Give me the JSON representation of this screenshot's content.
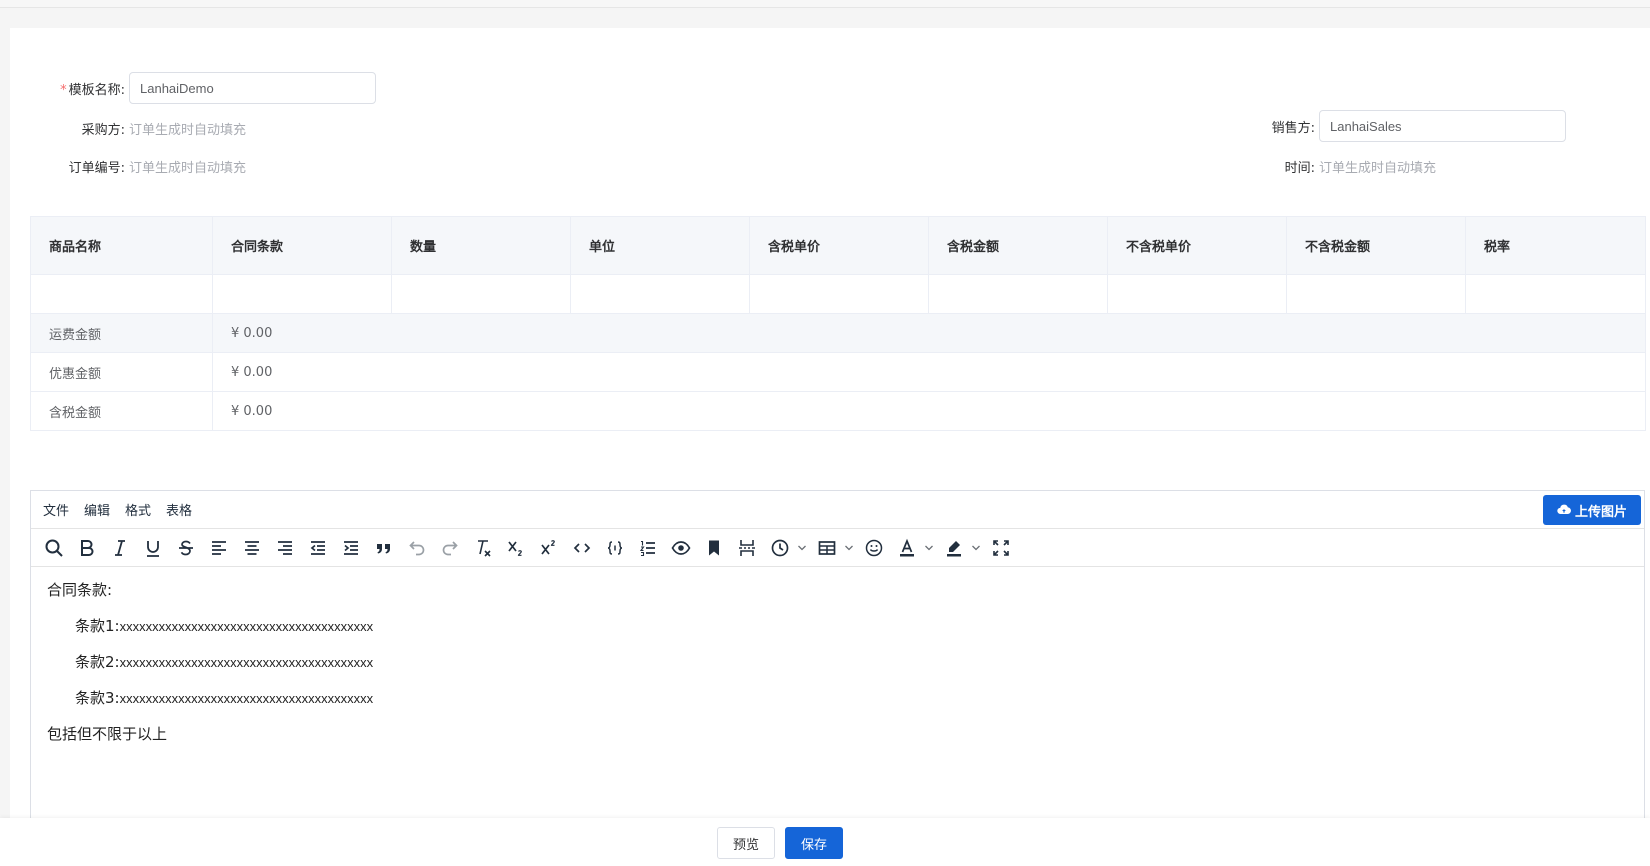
{
  "form": {
    "template_name_label": "模板名称:",
    "template_name_value": "LanhaiDemo",
    "buyer_label": "采购方:",
    "buyer_hint": "订单生成时自动填充",
    "seller_label": "销售方:",
    "seller_value": "LanhaiSales",
    "order_no_label": "订单编号:",
    "order_no_hint": "订单生成时自动填充",
    "time_label": "时间:",
    "time_hint": "订单生成时自动填充"
  },
  "table": {
    "headers": [
      "商品名称",
      "合同条款",
      "数量",
      "单位",
      "含税单价",
      "含税金额",
      "不含税单价",
      "不含税金额",
      "税率"
    ],
    "summary": [
      {
        "label": "运费金额",
        "value": "¥ 0.00"
      },
      {
        "label": "优惠金额",
        "value": "¥ 0.00"
      },
      {
        "label": "含税金额",
        "value": "¥ 0.00"
      }
    ]
  },
  "editor": {
    "menus": [
      "文件",
      "编辑",
      "格式",
      "表格"
    ],
    "upload_label": "上传图片",
    "content": {
      "heading": "合同条款:",
      "clauses": [
        {
          "label": "条款1:",
          "text": "xxxxxxxxxxxxxxxxxxxxxxxxxxxxxxxxxxxxxxx"
        },
        {
          "label": "条款2:",
          "text": "xxxxxxxxxxxxxxxxxxxxxxxxxxxxxxxxxxxxxxx"
        },
        {
          "label": "条款3:",
          "text": "xxxxxxxxxxxxxxxxxxxxxxxxxxxxxxxxxxxxxxx"
        }
      ],
      "footer": "包括但不限于以上"
    }
  },
  "footer": {
    "preview_label": "预览",
    "save_label": "保存"
  },
  "colors": {
    "primary": "#1565d8",
    "required": "#f56c6c",
    "hint": "#a8abb2"
  }
}
